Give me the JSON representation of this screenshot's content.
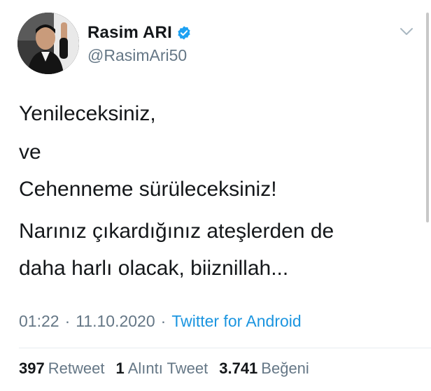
{
  "author": {
    "display_name": "Rasim ARI",
    "handle": "@RasimAri50",
    "verified": true,
    "avatar_icon": "profile-photo"
  },
  "tweet": {
    "lines": [
      "Yenileceksiniz,",
      "ve",
      "Cehenneme sürüleceksiniz!",
      "Narınız çıkardığınız ateşlerden de",
      "daha harlı olacak, biiznillah..."
    ],
    "time": "01:22",
    "date": "11.10.2020",
    "separator": "·",
    "source": "Twitter for Android"
  },
  "stats": {
    "retweets_count": "397",
    "retweets_label": "Retweet",
    "quotes_count": "1",
    "quotes_label": "Alıntı Tweet",
    "likes_count": "3.741",
    "likes_label": "Beğeni"
  },
  "colors": {
    "text": "#14171a",
    "secondary": "#657786",
    "link": "#1b95e0",
    "verified": "#1da1f2"
  }
}
